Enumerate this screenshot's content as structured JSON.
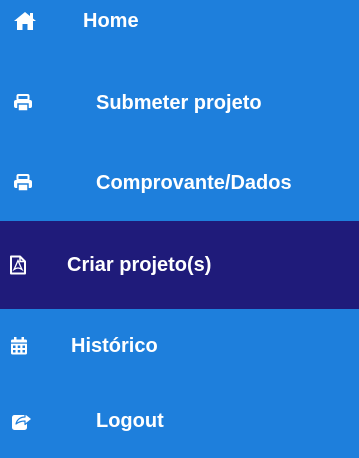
{
  "menu": {
    "items": [
      {
        "label": "Home",
        "icon": "home-icon"
      },
      {
        "label": "Submeter projeto",
        "icon": "printer-icon"
      },
      {
        "label": "Comprovante/Dados",
        "icon": "printer-icon"
      },
      {
        "label": "Criar projeto(s)",
        "icon": "pdf-file-icon",
        "active": true
      },
      {
        "label": "Histórico",
        "icon": "calendar-icon"
      },
      {
        "label": "Logout",
        "icon": "share-icon"
      }
    ]
  },
  "colors": {
    "background": "#1e7fdc",
    "active_background": "#1f1b7a",
    "text": "#ffffff"
  }
}
